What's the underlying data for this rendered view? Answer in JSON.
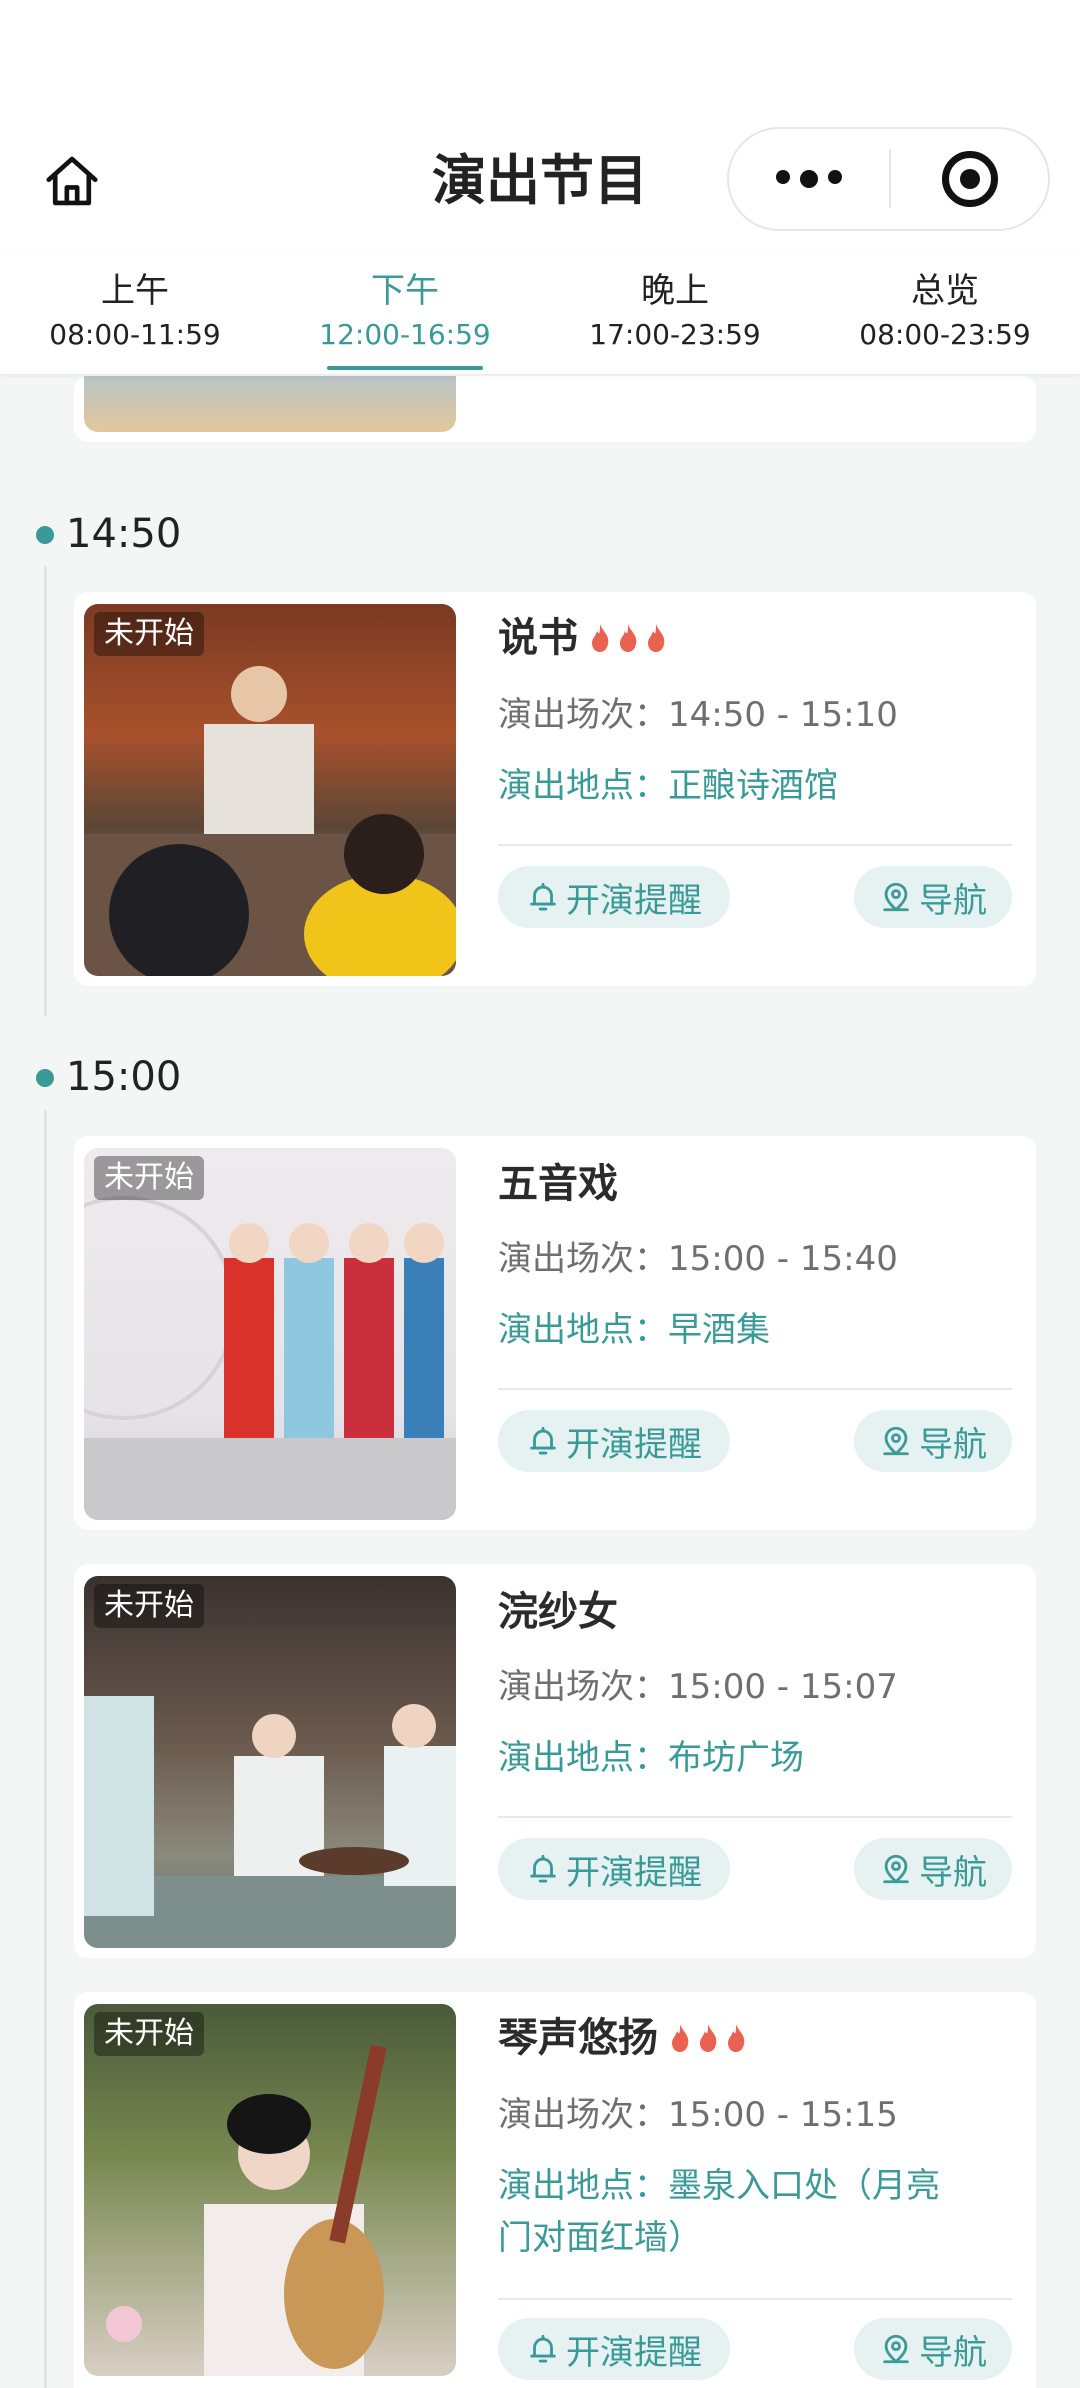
{
  "header": {
    "title": "演出节目"
  },
  "tabs": [
    {
      "label": "上午",
      "range": "08:00-11:59",
      "active": false
    },
    {
      "label": "下午",
      "range": "12:00-16:59",
      "active": true
    },
    {
      "label": "晚上",
      "range": "17:00-23:59",
      "active": false
    },
    {
      "label": "总览",
      "range": "08:00-23:59",
      "active": false
    }
  ],
  "labels": {
    "status_not_started": "未开始",
    "session_prefix": "演出场次：",
    "location_prefix": "演出地点：",
    "remind": "开演提醒",
    "navigate": "导航"
  },
  "time_groups": [
    {
      "time": "14:50"
    },
    {
      "time": "15:00"
    }
  ],
  "shows": [
    {
      "title": "说书",
      "hot": true,
      "session": "14:50 - 15:10",
      "location": "正酿诗酒馆",
      "status": "未开始"
    },
    {
      "title": "五音戏",
      "hot": false,
      "session": "15:00 - 15:40",
      "location": "早酒集",
      "status": "未开始"
    },
    {
      "title": "浣纱女",
      "hot": false,
      "session": "15:00 - 15:07",
      "location": "布坊广场",
      "status": "未开始"
    },
    {
      "title": "琴声悠扬",
      "hot": true,
      "session": "15:00 - 15:15",
      "location": "墨泉入口处（月亮",
      "location_line2": "门对面红墙）",
      "status": "未开始"
    }
  ],
  "colors": {
    "accent": "#3a9a98",
    "button_bg": "#e5f2f1",
    "flame": "#e8624f",
    "page_bg": "#f4f6f5"
  },
  "icons": {
    "home": "home-icon",
    "more": "more-dots-icon",
    "close": "target-icon",
    "remind": "bell-icon",
    "navigate": "location-pin-icon",
    "hot": "flame-icon"
  }
}
